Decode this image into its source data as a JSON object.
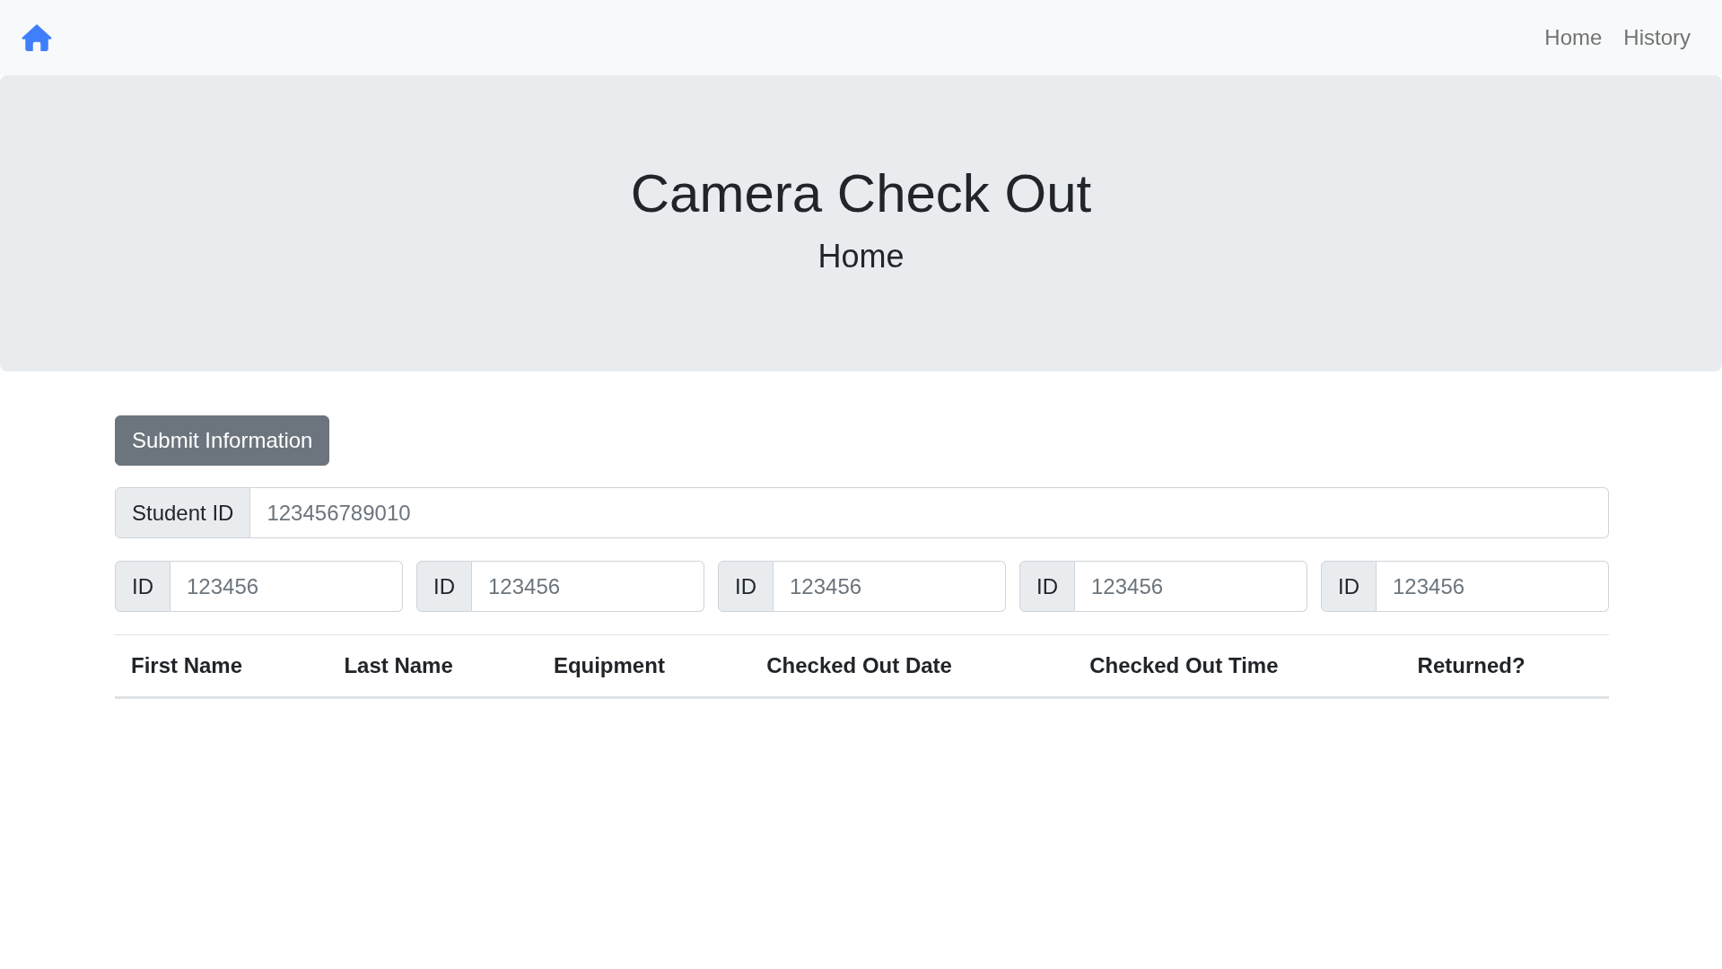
{
  "navbar": {
    "links": [
      {
        "label": "Home"
      },
      {
        "label": "History"
      }
    ]
  },
  "header": {
    "title": "Camera Check Out",
    "subtitle": "Home"
  },
  "form": {
    "submit_button": "Submit Information",
    "student_id": {
      "label": "Student ID",
      "placeholder": "123456789010"
    },
    "equipment_ids": [
      {
        "label": "ID",
        "placeholder": "123456"
      },
      {
        "label": "ID",
        "placeholder": "123456"
      },
      {
        "label": "ID",
        "placeholder": "123456"
      },
      {
        "label": "ID",
        "placeholder": "123456"
      },
      {
        "label": "ID",
        "placeholder": "123456"
      }
    ]
  },
  "table": {
    "columns": [
      "First Name",
      "Last Name",
      "Equipment",
      "Checked Out Date",
      "Checked Out Time",
      "Returned?"
    ]
  }
}
